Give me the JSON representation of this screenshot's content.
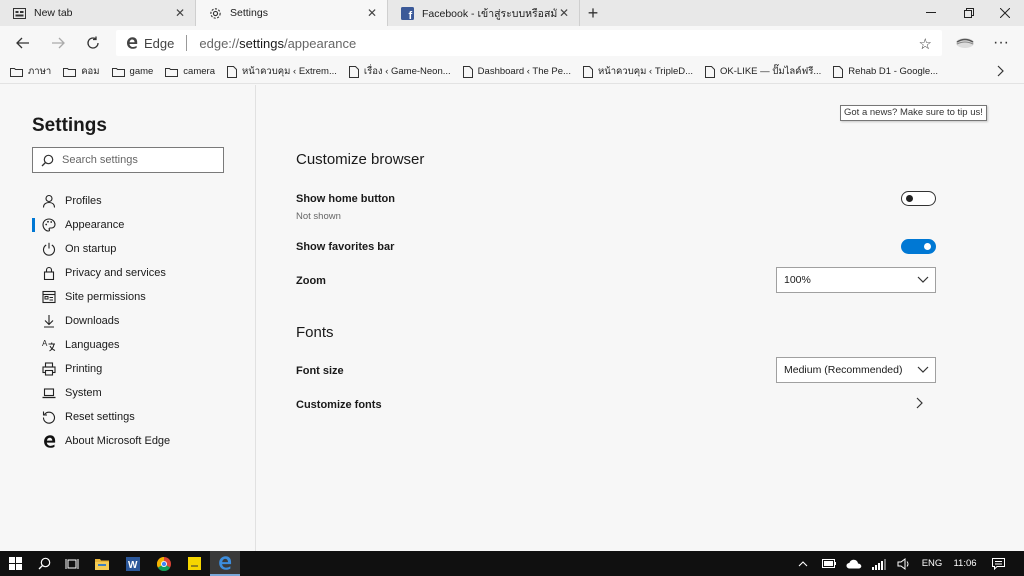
{
  "tabs": [
    {
      "label": "New tab",
      "icon": "newtab-icon"
    },
    {
      "label": "Settings",
      "icon": "gear-icon",
      "active": true
    },
    {
      "label": "Facebook - เข้าสู่ระบบหรือสมัครใช้งาน",
      "icon": "facebook-icon"
    }
  ],
  "omnibox": {
    "brand": "Edge",
    "url_scheme": "edge://",
    "url_host": "settings",
    "url_path": "/appearance"
  },
  "favorites": [
    {
      "label": "ภาษา",
      "type": "folder"
    },
    {
      "label": "คอม",
      "type": "folder"
    },
    {
      "label": "game",
      "type": "folder"
    },
    {
      "label": "camera",
      "type": "folder"
    },
    {
      "label": "หน้าควบคุม ‹ Extrem...",
      "type": "page"
    },
    {
      "label": "เรื่อง ‹ Game-Neon...",
      "type": "page"
    },
    {
      "label": "Dashboard ‹ The Pe...",
      "type": "page"
    },
    {
      "label": "หน้าควบคุม ‹ TripleD...",
      "type": "page"
    },
    {
      "label": "OK-LIKE — ปั๊มไลค์ฟรี...",
      "type": "page"
    },
    {
      "label": "Rehab D1 - Google...",
      "type": "page"
    }
  ],
  "sidebar": {
    "title": "Settings",
    "search_placeholder": "Search settings",
    "items": [
      {
        "label": "Profiles",
        "icon": "person-icon"
      },
      {
        "label": "Appearance",
        "icon": "palette-icon",
        "active": true
      },
      {
        "label": "On startup",
        "icon": "power-icon"
      },
      {
        "label": "Privacy and services",
        "icon": "lock-icon"
      },
      {
        "label": "Site permissions",
        "icon": "site-permissions-icon"
      },
      {
        "label": "Downloads",
        "icon": "download-icon"
      },
      {
        "label": "Languages",
        "icon": "language-icon"
      },
      {
        "label": "Printing",
        "icon": "printer-icon"
      },
      {
        "label": "System",
        "icon": "laptop-icon"
      },
      {
        "label": "Reset settings",
        "icon": "reset-icon"
      },
      {
        "label": "About Microsoft Edge",
        "icon": "edge-logo-icon"
      }
    ]
  },
  "main": {
    "tooltip": "Got a news? Make sure to tip us!",
    "customize_title": "Customize browser",
    "home_button_label": "Show home button",
    "home_button_status": "Not shown",
    "home_button_on": false,
    "favorites_bar_label": "Show favorites bar",
    "favorites_bar_on": true,
    "zoom_label": "Zoom",
    "zoom_value": "100%",
    "fonts_title": "Fonts",
    "font_size_label": "Font size",
    "font_size_value": "Medium (Recommended)",
    "customize_fonts_label": "Customize fonts"
  },
  "taskbar": {
    "language": "ENG",
    "time": "11:06"
  },
  "colors": {
    "accent": "#0078d4",
    "taskbar": "#101010"
  }
}
